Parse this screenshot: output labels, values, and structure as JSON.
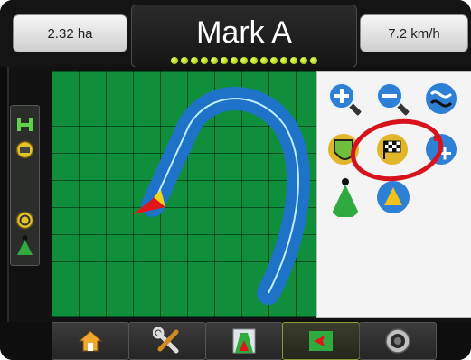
{
  "header": {
    "area": "2.32 ha",
    "title": "Mark A",
    "speed": "7.2 km/h"
  },
  "lightbar": {
    "led_count": 15,
    "led_color": "#b6e000"
  },
  "side_toolbar": {
    "icons": [
      "implement-icon",
      "rate-control-icon",
      "steering-icon",
      "vehicle-icon"
    ]
  },
  "map_panel": {
    "buttons": [
      "zoom-in-icon",
      "zoom-out-icon",
      "guideline-curve-icon",
      "boundary-icon",
      "mark-flag-icon",
      "add-mark-icon",
      "vehicle-view-icon",
      "perspective-view-icon"
    ],
    "highlighted": "mark-flag-icon"
  },
  "bottom_tabs": [
    {
      "name": "home-tab",
      "icon": "home-icon",
      "active": false
    },
    {
      "name": "tools-tab",
      "icon": "wrench-screwdriver-icon",
      "active": false
    },
    {
      "name": "guidance-tab",
      "icon": "guidance-road-icon",
      "active": false
    },
    {
      "name": "map-tab",
      "icon": "map-marker-icon",
      "active": true
    },
    {
      "name": "camera-tab",
      "icon": "camera-icon",
      "active": false
    }
  ],
  "colors": {
    "field": "#0f8f3b",
    "path": "#1e73c8",
    "vehicle": "#e0161a",
    "highlight_ring": "#d6121c",
    "active_tab_border": "#8e9a3a"
  }
}
